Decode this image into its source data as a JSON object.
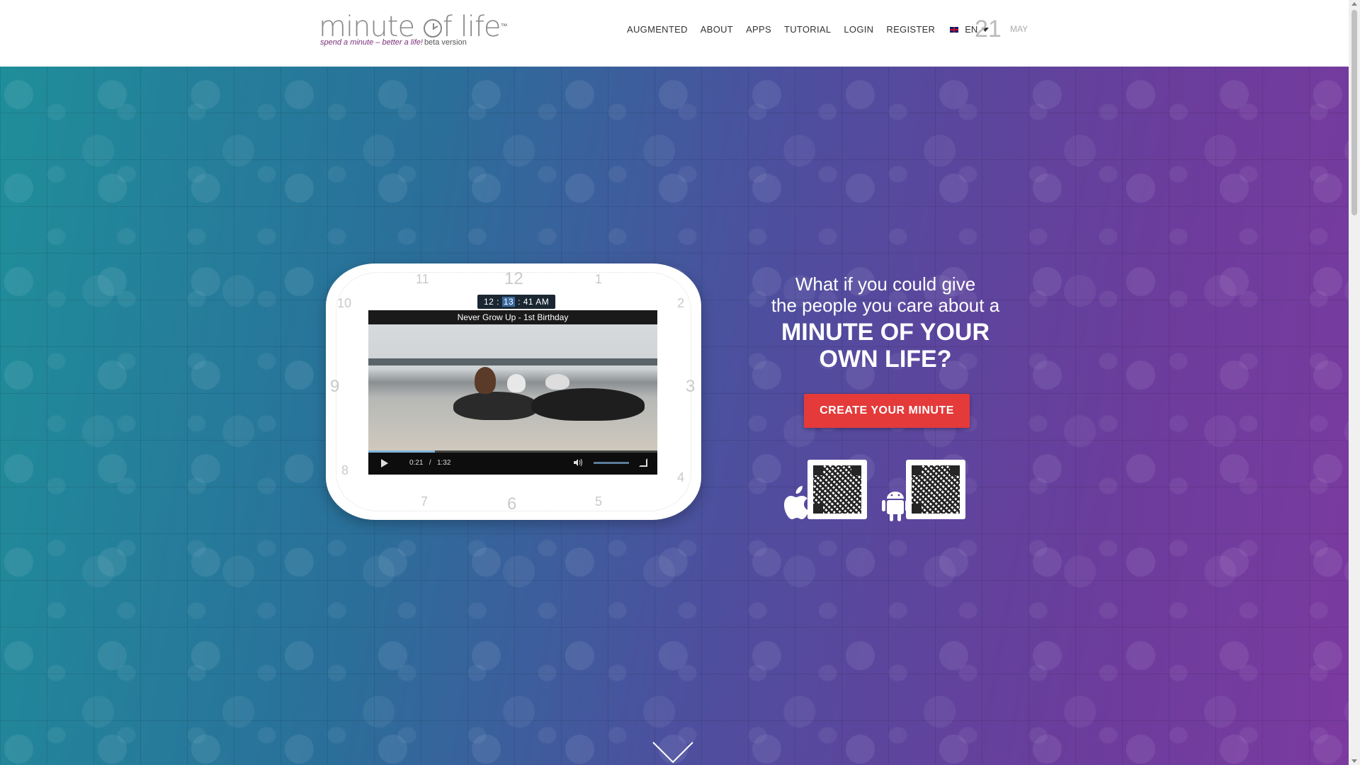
{
  "header": {
    "logo": {
      "text_main_before": "minute ",
      "text_main_after": "f life",
      "tm": "™",
      "tagline": "spend a minute – better a life!",
      "beta": "beta version"
    },
    "nav": [
      {
        "label": "AUGMENTED"
      },
      {
        "label": "ABOUT"
      },
      {
        "label": "APPS"
      },
      {
        "label": "TUTORIAL"
      },
      {
        "label": "LOGIN"
      },
      {
        "label": "REGISTER"
      }
    ],
    "language": {
      "value": "EN",
      "flag_icon": "uk-flag-icon"
    },
    "date": {
      "day": "21",
      "month": "MAY"
    }
  },
  "hero": {
    "clock": {
      "numbers": [
        "12",
        "1",
        "2",
        "3",
        "4",
        "5",
        "6",
        "7",
        "8",
        "9",
        "10",
        "11"
      ],
      "time_before": "12 : ",
      "time_highlight": "13",
      "time_after": " : 41 AM"
    },
    "video": {
      "title": "Never Grow Up - 1st Birthday",
      "current_time": "0:21",
      "separator": "/",
      "duration": "1:32",
      "progress": 0.23,
      "volume": 0.8
    },
    "headline": {
      "line1": "What if you could give",
      "line2": "the people you care about a",
      "line3": "MINUTE OF YOUR",
      "line4": "OWN LIFE?"
    },
    "cta_label": "CREATE YOUR MINUTE",
    "apps": [
      {
        "platform_icon": "apple-icon"
      },
      {
        "platform_icon": "android-icon"
      }
    ]
  },
  "colors": {
    "accent": "#e43a3a",
    "logo_text": "#8a8a8a",
    "tagline": "#7a2f7a",
    "hero_start": "#1f8e9a",
    "hero_end": "#7b3aa0"
  }
}
